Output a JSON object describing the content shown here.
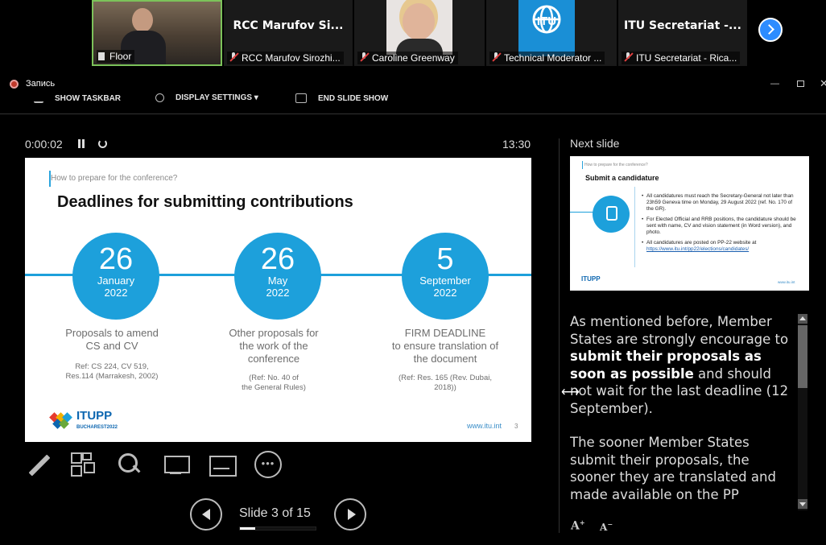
{
  "participants": [
    {
      "name": "",
      "label": "Floor"
    },
    {
      "name": "RCC Marufov Si...",
      "label": "RCC Marufov Sirozhi..."
    },
    {
      "name": "",
      "label": "Caroline Greenway"
    },
    {
      "name": "",
      "label": "Technical Moderator ..."
    },
    {
      "name": "ITU Secretariat -...",
      "label": "ITU Secretariat - Rica..."
    }
  ],
  "recording_label": "Запись",
  "toolbar": {
    "show_taskbar": "SHOW TASKBAR",
    "display_settings": "DISPLAY SETTINGS ▾",
    "end_slide_show": "END SLIDE SHOW"
  },
  "presenter": {
    "elapsed": "0:00:02",
    "clock": "13:30",
    "slide_counter": "Slide 3 of 15",
    "progress": 0.2
  },
  "slide": {
    "pretitle": "How to prepare for the conference?",
    "title": "Deadlines for submitting contributions",
    "deadlines": [
      {
        "day": "26",
        "month": "January",
        "year": "2022",
        "heading": "Proposals to amend\nCS and CV",
        "ref": "Ref: CS 224, CV 519,\nRes.114 (Marrakesh, 2002)"
      },
      {
        "day": "26",
        "month": "May",
        "year": "2022",
        "heading": "Other proposals for\nthe work of the\nconference",
        "ref": "(Ref: No. 40 of\nthe General Rules)"
      },
      {
        "day": "5",
        "month": "September",
        "year": "2022",
        "heading": "FIRM DEADLINE\nto ensure translation of\nthe document",
        "ref": "(Ref: Res. 165 (Rev. Dubai,\n2018))"
      }
    ],
    "logo_text": "ITUPP",
    "logo_sub": "BUCHAREST2022",
    "url": "www.itu.int",
    "page_number": "3"
  },
  "next_slide": {
    "label": "Next slide",
    "pretitle": "How to prepare for the conference?",
    "title": "Submit a candidature",
    "bullets": [
      "All candidatures must reach the Secretary-General not later than 23h59 Geneva time on Monday, 29 August 2022 (ref. No. 170 of the GR).",
      "For Elected Official and RRB positions, the candidature should be sent with name, CV and vision statement (in Word version), and photo.",
      "All candidatures are posted on PP-22 website at"
    ],
    "link": "https://www.itu.int/pp22/elections/candidates/",
    "logo_text": "ITUPP",
    "url": "www.itu.int"
  },
  "notes": {
    "p1_a": "As mentioned before, Member States are strongly encourage to ",
    "p1_bold": "submit their proposals as soon as possible",
    "p1_b": " and should not wait for the last deadline (12 September).",
    "p2": "The sooner Member States submit their proposals, the sooner they are translated and made available on the PP website for proper"
  },
  "colors": {
    "accent": "#1da0db",
    "zoom_blue": "#2d8cff",
    "background": "#000000"
  }
}
